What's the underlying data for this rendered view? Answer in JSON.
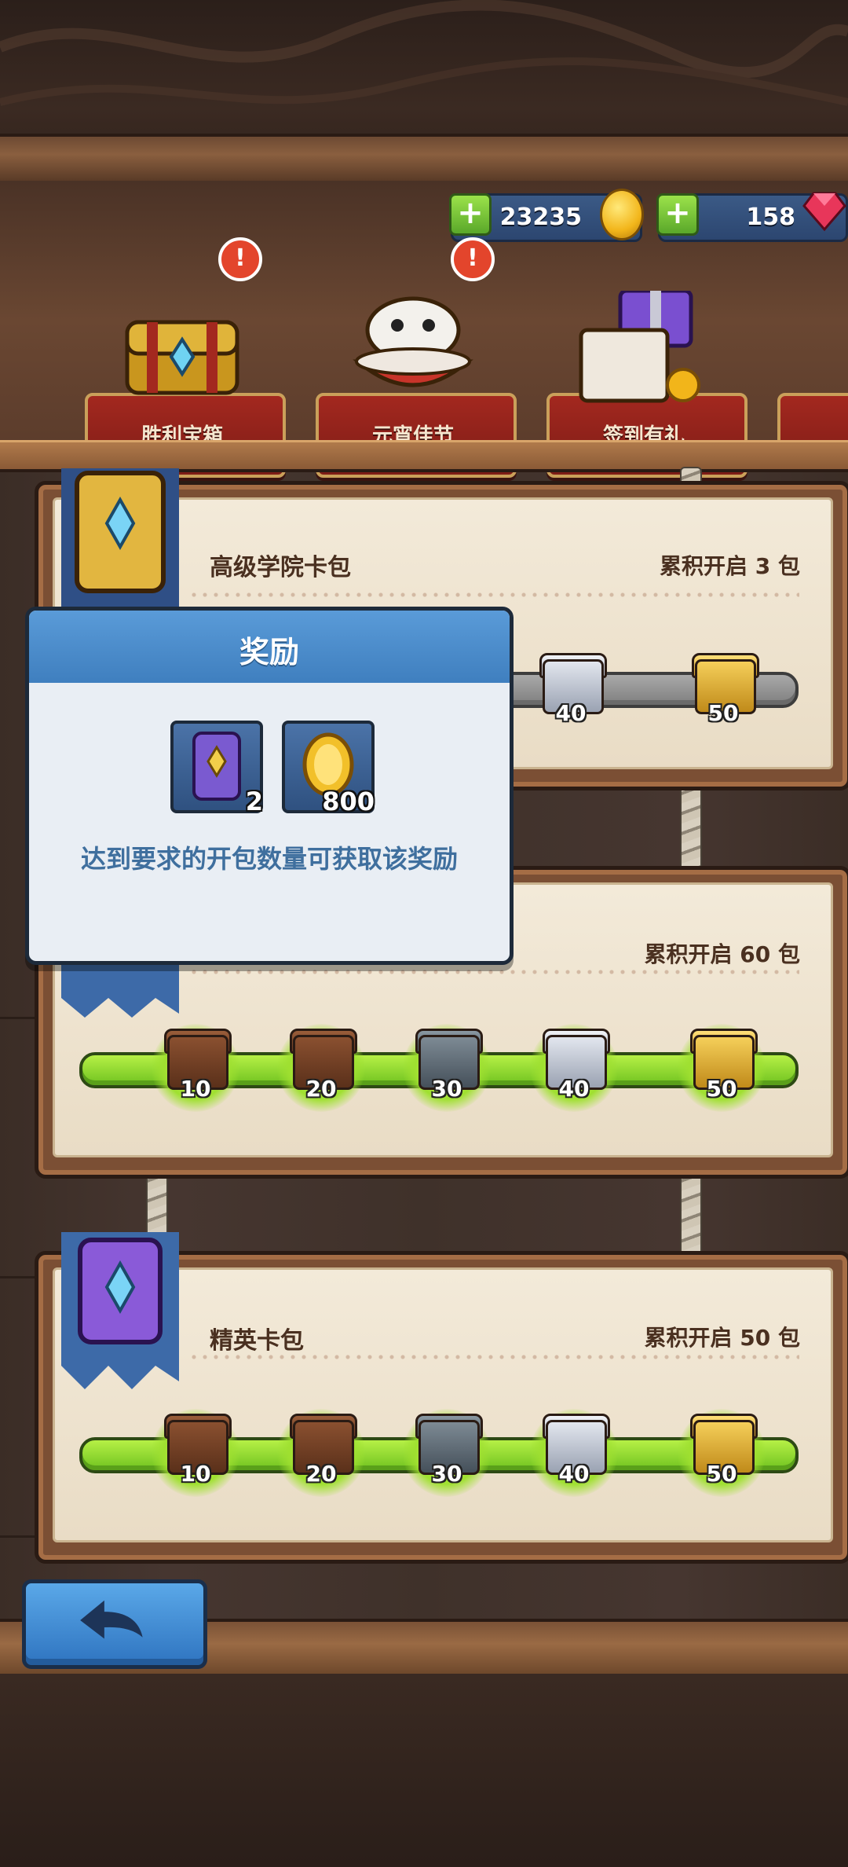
{
  "currency": {
    "coins": "23235",
    "gems": "158"
  },
  "events": [
    {
      "label": "胜利宝箱",
      "badge": "!"
    },
    {
      "label": "元宵佳节",
      "badge": "!"
    },
    {
      "label": "签到有礼",
      "badge": ""
    },
    {
      "label": "",
      "badge": ""
    }
  ],
  "packs": [
    {
      "name": "高级学院卡包",
      "requirement": "累积开启 3 包",
      "milestones": [
        "40",
        "50"
      ]
    },
    {
      "name": "",
      "requirement": "累积开启 60 包",
      "milestones": [
        "10",
        "20",
        "30",
        "40",
        "50"
      ]
    },
    {
      "name": "精英卡包",
      "requirement": "累积开启 50 包",
      "milestones": [
        "10",
        "20",
        "30",
        "40",
        "50"
      ]
    }
  ],
  "reward_popup": {
    "title": "奖励",
    "items": [
      {
        "icon": "card-pack-icon",
        "count": "2"
      },
      {
        "icon": "gold-coin-icon",
        "count": "800"
      }
    ],
    "message": "达到要求的开包数量可获取该奖励"
  },
  "colors": {
    "accent_blue": "#3f7fbf",
    "progress_green": "#8fd82a",
    "event_red": "#a3281f"
  }
}
